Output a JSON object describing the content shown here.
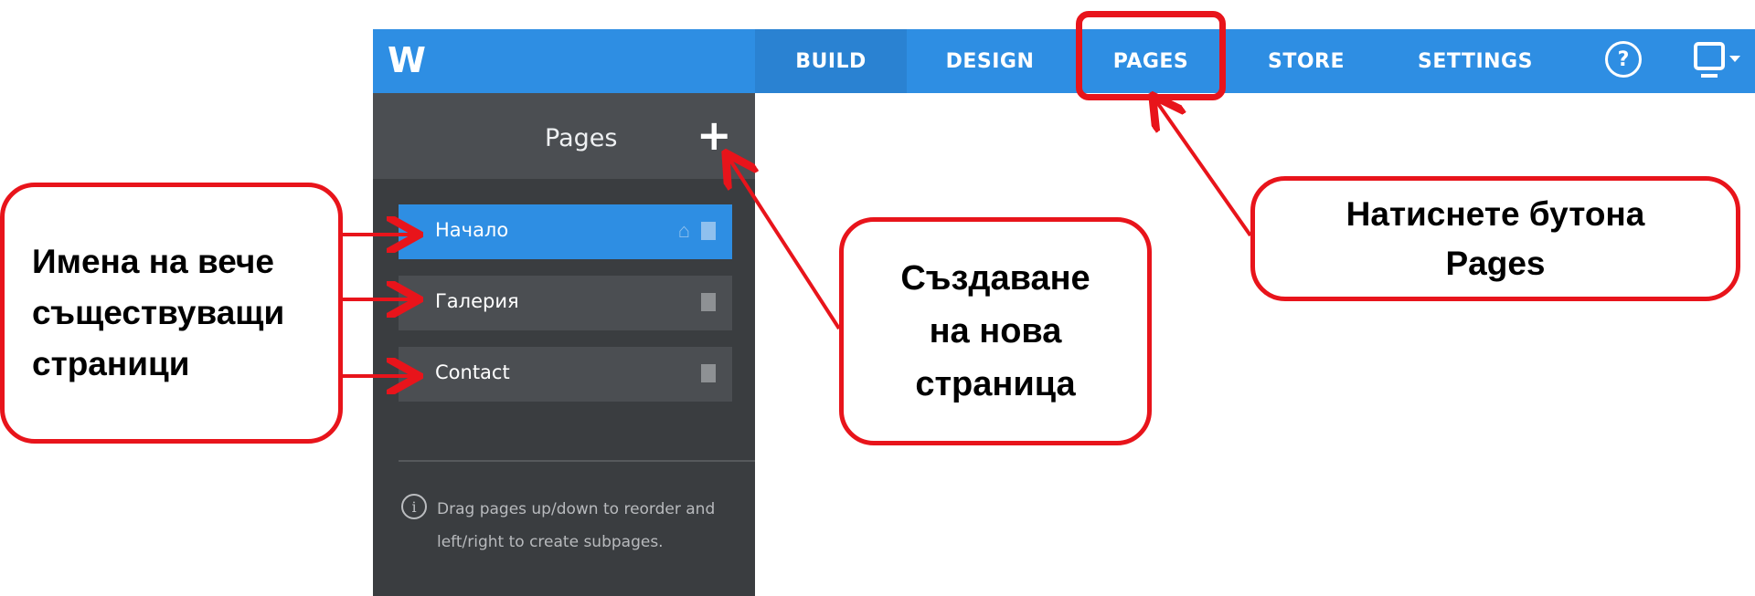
{
  "app": {
    "logo": "W"
  },
  "nav": {
    "tabs": [
      {
        "label": "BUILD"
      },
      {
        "label": "DESIGN"
      },
      {
        "label": "PAGES"
      },
      {
        "label": "STORE"
      },
      {
        "label": "SETTINGS"
      }
    ],
    "help_label": "?"
  },
  "sidebar": {
    "title": "Pages",
    "add_label": "+",
    "pages": [
      {
        "label": "Начало",
        "selected": true,
        "home": true
      },
      {
        "label": "Галерия",
        "selected": false,
        "home": false
      },
      {
        "label": "Contact",
        "selected": false,
        "home": false
      }
    ],
    "info": "Drag pages up/down to reorder and left/right to create subpages.",
    "info_icon": "i"
  },
  "callouts": {
    "left": [
      "Имена на вече",
      "съществуващи",
      "страници"
    ],
    "middle": [
      "Създаване",
      "на нова",
      "страница"
    ],
    "right": [
      "Натиснете бутона",
      "Pages"
    ]
  },
  "colors": {
    "topbar": "#2e8ee3",
    "sidebar": "#3a3d40",
    "sidebar_header": "#4b4e52",
    "selected_item": "#2e8ee3",
    "annotation_red": "#e8141b"
  }
}
